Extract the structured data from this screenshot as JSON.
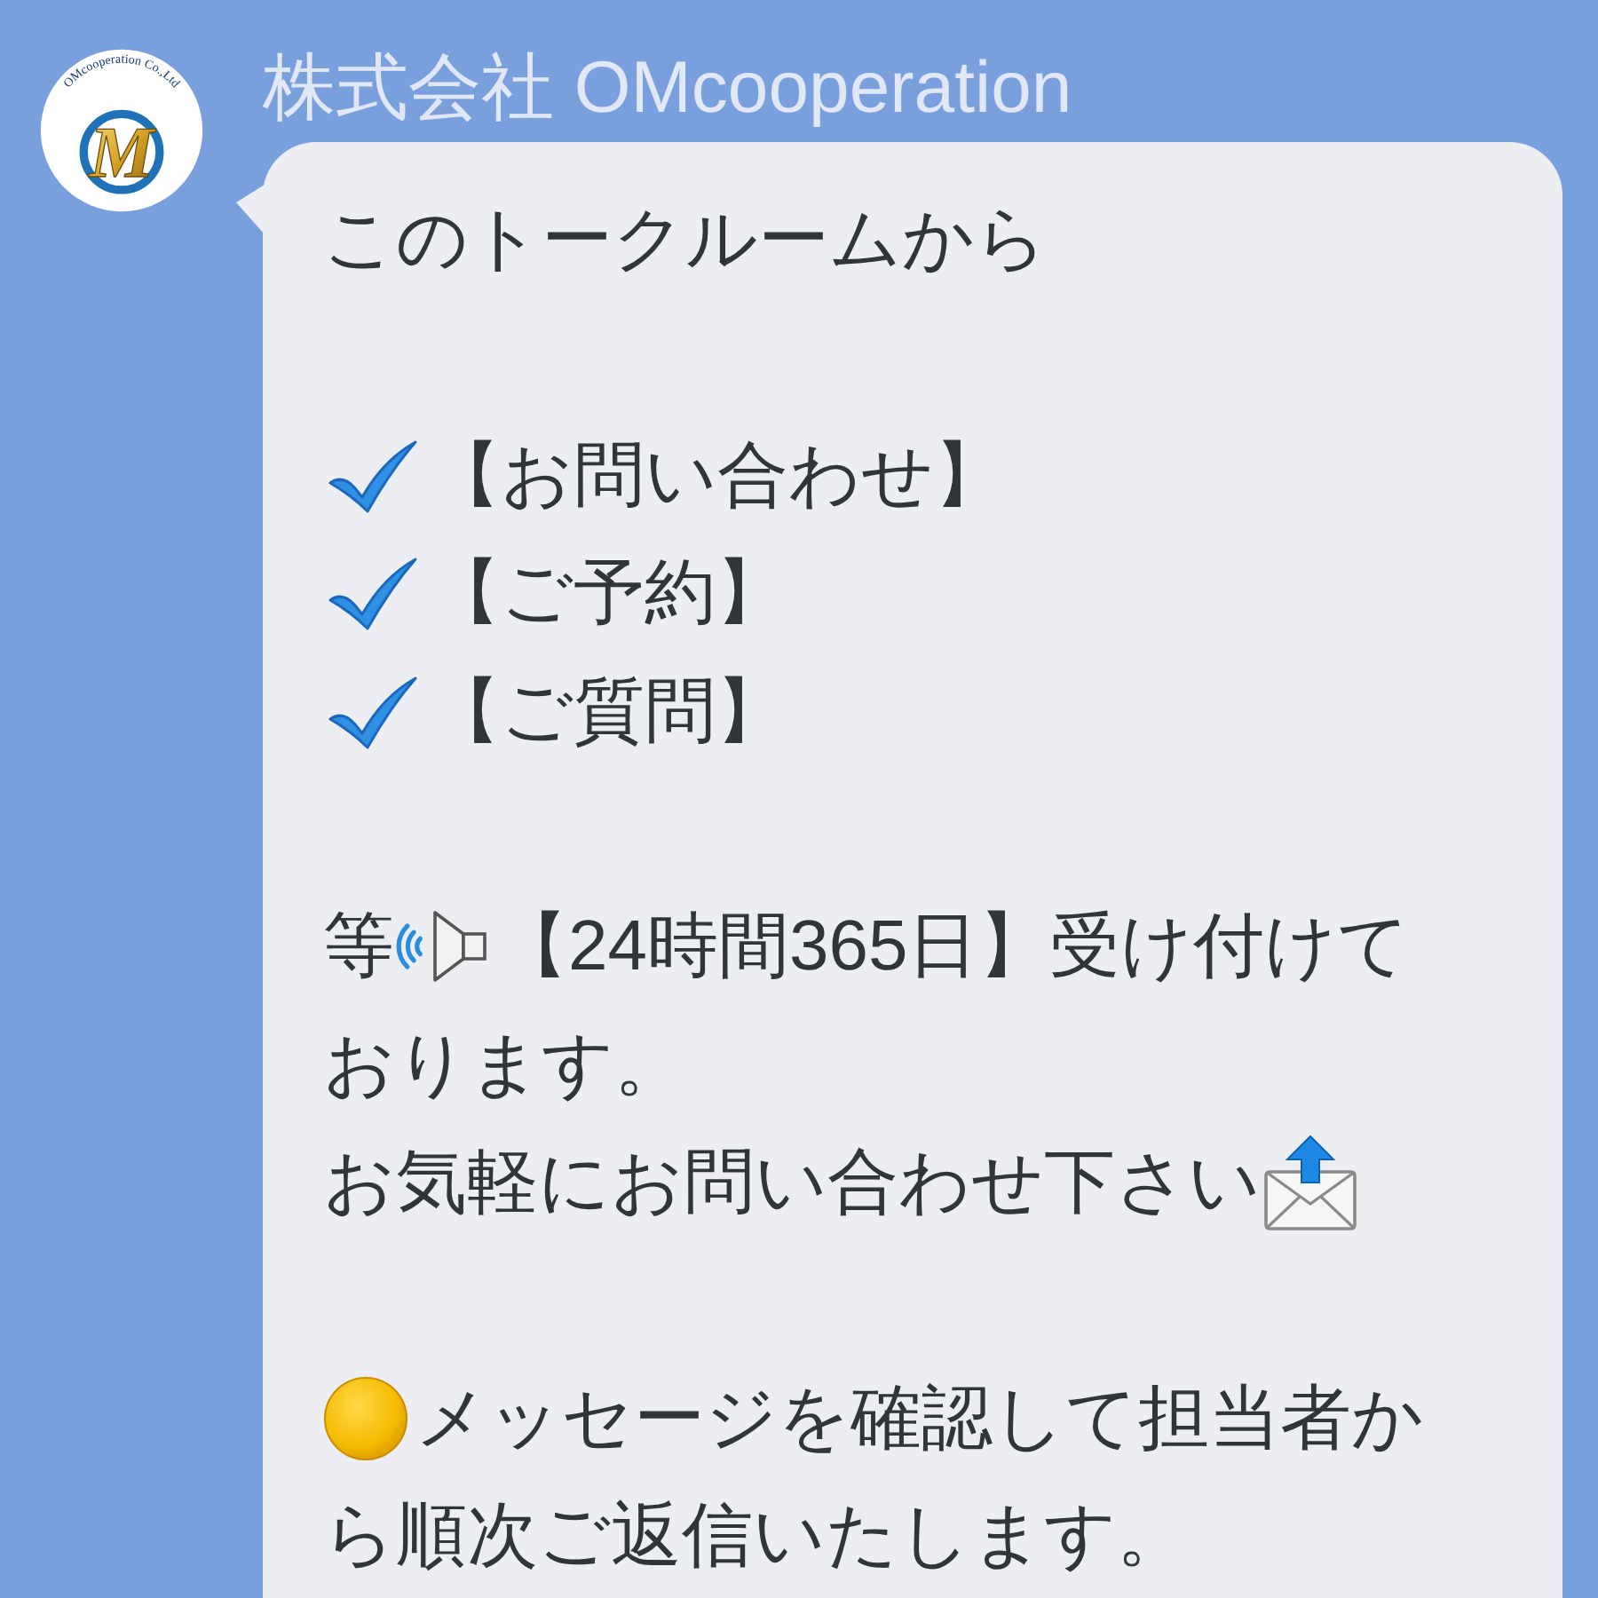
{
  "sender": {
    "name": "株式会社 OMcooperation",
    "logo": {
      "ring_text": "OMcooperation Co.,Ltd",
      "monogram": "M"
    }
  },
  "message": {
    "paragraphs": [
      {
        "lines": [
          [
            {
              "kind": "text",
              "text": "このトークルームから"
            }
          ]
        ]
      },
      {
        "lines": [
          [
            {
              "kind": "check"
            },
            {
              "kind": "text",
              "text": "【お問い合わせ】"
            }
          ],
          [
            {
              "kind": "check"
            },
            {
              "kind": "text",
              "text": "【ご予約】"
            }
          ],
          [
            {
              "kind": "check"
            },
            {
              "kind": "text",
              "text": "【ご質問】"
            }
          ]
        ]
      },
      {
        "lines": [
          [
            {
              "kind": "text",
              "text": "等"
            },
            {
              "kind": "speaker"
            },
            {
              "kind": "text",
              "text": "【24時間365日】受け付けて"
            }
          ],
          [
            {
              "kind": "text",
              "text": "おります。"
            }
          ],
          [
            {
              "kind": "text",
              "text": "お気軽にお問い合わせ下さい"
            },
            {
              "kind": "mail"
            }
          ]
        ]
      },
      {
        "lines": [
          [
            {
              "kind": "dot"
            },
            {
              "kind": "text",
              "text": "メッセージを確認して担当者か"
            }
          ],
          [
            {
              "kind": "text",
              "text": "ら順次ご返信いたします。"
            }
          ]
        ]
      }
    ]
  }
}
